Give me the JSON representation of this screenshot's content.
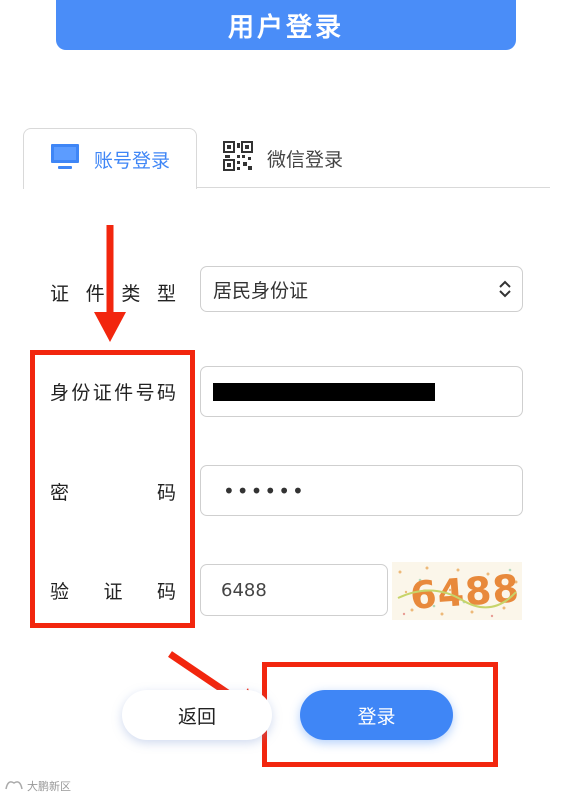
{
  "header": {
    "title": "用户登录"
  },
  "tabs": [
    {
      "label": "账号登录",
      "icon": "monitor-icon",
      "active": true
    },
    {
      "label": "微信登录",
      "icon": "qr-code-icon",
      "active": false
    }
  ],
  "form": {
    "id_type": {
      "label": "证件类型",
      "label_chars": [
        "证",
        "件",
        "类",
        "型"
      ],
      "value": "居民身份证"
    },
    "id_number": {
      "label": "身份证件号码",
      "label_chars": [
        "身",
        "份",
        "证",
        "件",
        "号",
        "码"
      ]
    },
    "password": {
      "label": "密码",
      "label_chars": [
        "密",
        "码"
      ],
      "value": "••••••"
    },
    "captcha": {
      "label": "验证码",
      "label_chars": [
        "验",
        "证",
        "码"
      ],
      "value": "6488",
      "image_text": "6488"
    }
  },
  "buttons": {
    "back": "返回",
    "login": "登录"
  },
  "watermark": "大鹏新区",
  "colors": {
    "primary": "#3f86f6",
    "header": "#4a8df8",
    "annotation": "#f2260e"
  }
}
